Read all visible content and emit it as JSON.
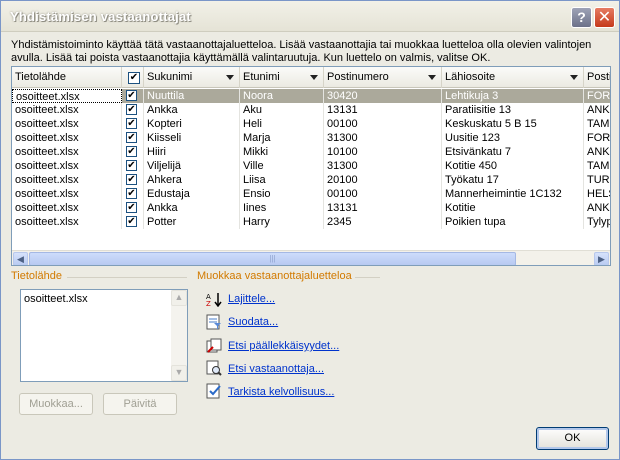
{
  "window": {
    "title": "Yhdistämisen vastaanottajat"
  },
  "description": "Yhdistämistoiminto käyttää tätä vastaanottajaluetteloa. Lisää vastaanottajia tai muokkaa luetteloa olla olevien valintojen avulla. Lisää tai poista vastaanottajia käyttämällä valintaruutuja. Kun luettelo on valmis, valitse OK.",
  "grid": {
    "headers": [
      "Tietolähde",
      "",
      "Sukunimi",
      "Etunimi",
      "Postinumero",
      "Lähiosoite",
      "Posti"
    ],
    "rows": [
      [
        "osoitteet.xlsx",
        "✔",
        "Nuuttila",
        "Noora",
        "30420",
        "Lehtikuja 3",
        "FORS"
      ],
      [
        "osoitteet.xlsx",
        "✔",
        "Ankka",
        "Aku",
        "13131",
        "Paratiisitie 13",
        "ANKK"
      ],
      [
        "osoitteet.xlsx",
        "✔",
        "Kopteri",
        "Heli",
        "00100",
        "Keskuskatu 5 B 15",
        "TAMN"
      ],
      [
        "osoitteet.xlsx",
        "✔",
        "Kiisseli",
        "Marja",
        "31300",
        "Uusitie 123",
        "FORS"
      ],
      [
        "osoitteet.xlsx",
        "✔",
        "Hiiri",
        "Mikki",
        "10100",
        "Etsivänkatu 7",
        "ANKK"
      ],
      [
        "osoitteet.xlsx",
        "✔",
        "Viljelijä",
        "Ville",
        "31300",
        "Kotitie 450",
        "TAMN"
      ],
      [
        "osoitteet.xlsx",
        "✔",
        "Ahkera",
        "Liisa",
        "20100",
        "Työkatu 17",
        "TURK"
      ],
      [
        "osoitteet.xlsx",
        "✔",
        "Edustaja",
        "Ensio",
        "00100",
        "Mannerheimintie 1C132",
        "HELS"
      ],
      [
        "osoitteet.xlsx",
        "✔",
        "Ankka",
        "Iines",
        "13131",
        "Kotitie",
        "ANKK"
      ],
      [
        "osoitteet.xlsx",
        "✔",
        "Potter",
        "Harry",
        "2345",
        "Poikien tupa",
        "Tylyp"
      ]
    ],
    "header_checkbox": "✔"
  },
  "source": {
    "title": "Tietolähde",
    "items": [
      "osoitteet.xlsx"
    ],
    "edit_button": "Muokkaa...",
    "refresh_button": "Päivitä"
  },
  "refine": {
    "title": "Muokkaa vastaanottajaluetteloa",
    "links": [
      "Lajittele...",
      "Suodata...",
      "Etsi päällekkäisyydet...",
      "Etsi vastaanottaja...",
      "Tarkista kelvollisuus..."
    ]
  },
  "ok_button": "OK",
  "colors": {
    "accent": "#d27a00",
    "link": "#0033cc",
    "selection": "#aba99b"
  }
}
